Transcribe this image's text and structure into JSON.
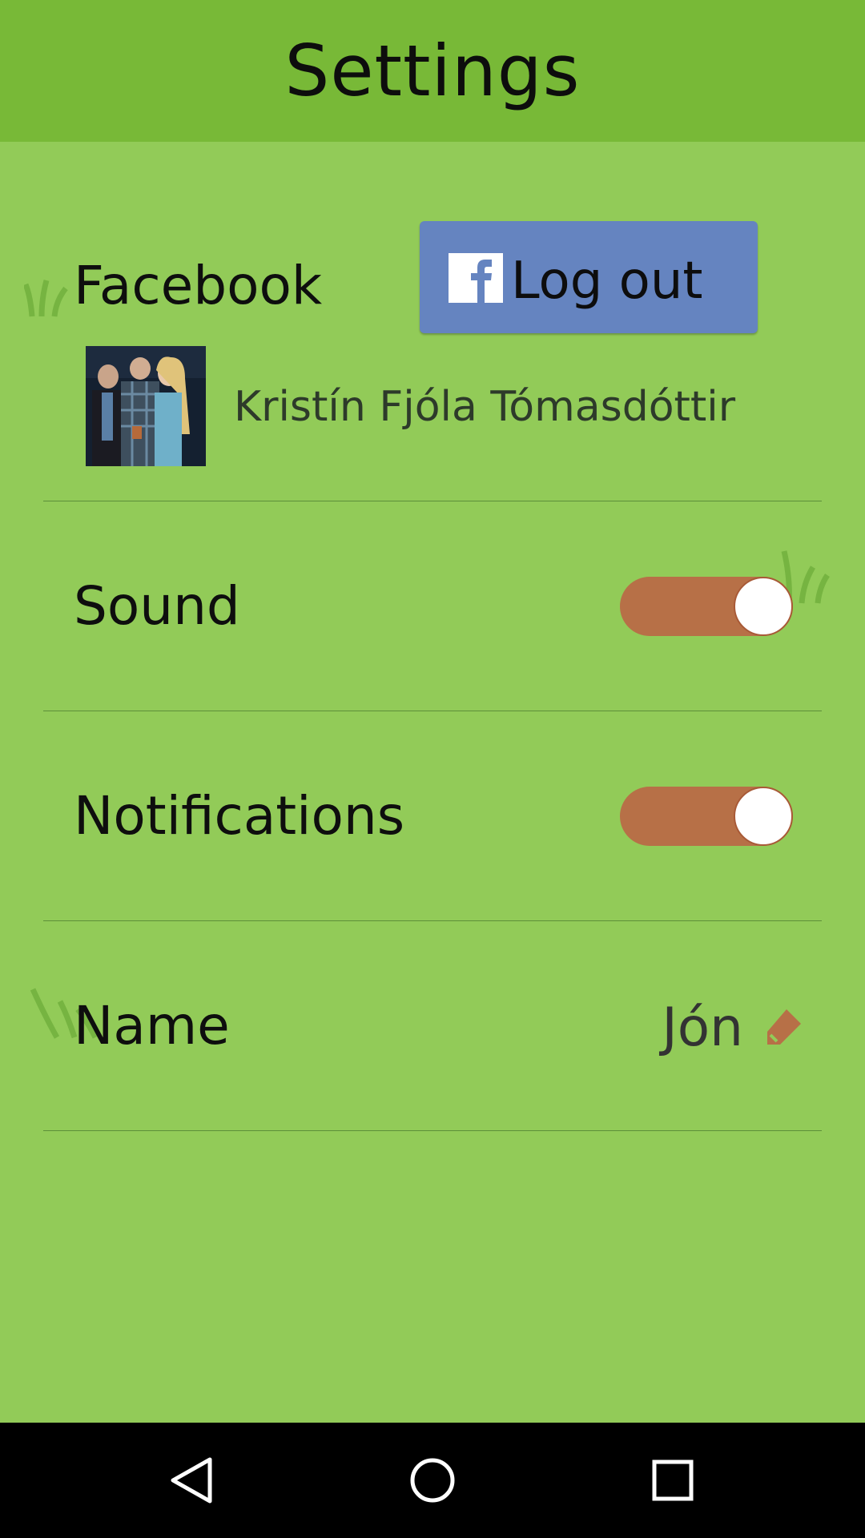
{
  "app_bar": {
    "title": "Settings",
    "color": "#78b937"
  },
  "background_color": "#92cb58",
  "facebook": {
    "label": "Facebook",
    "button_label": "Log out",
    "button_color": "#6584c0",
    "icon": "facebook-icon",
    "user_name": "Kristín Fjóla Tómasdóttir"
  },
  "sound": {
    "label": "Sound",
    "enabled": true
  },
  "notifications": {
    "label": "Notifications",
    "enabled": true
  },
  "name": {
    "label": "Name",
    "value": "Jón",
    "edit_icon": "pencil-icon"
  },
  "toggle_color": "#b77047",
  "nav": {
    "back": "back-icon",
    "home": "home-icon",
    "recents": "recents-icon"
  }
}
